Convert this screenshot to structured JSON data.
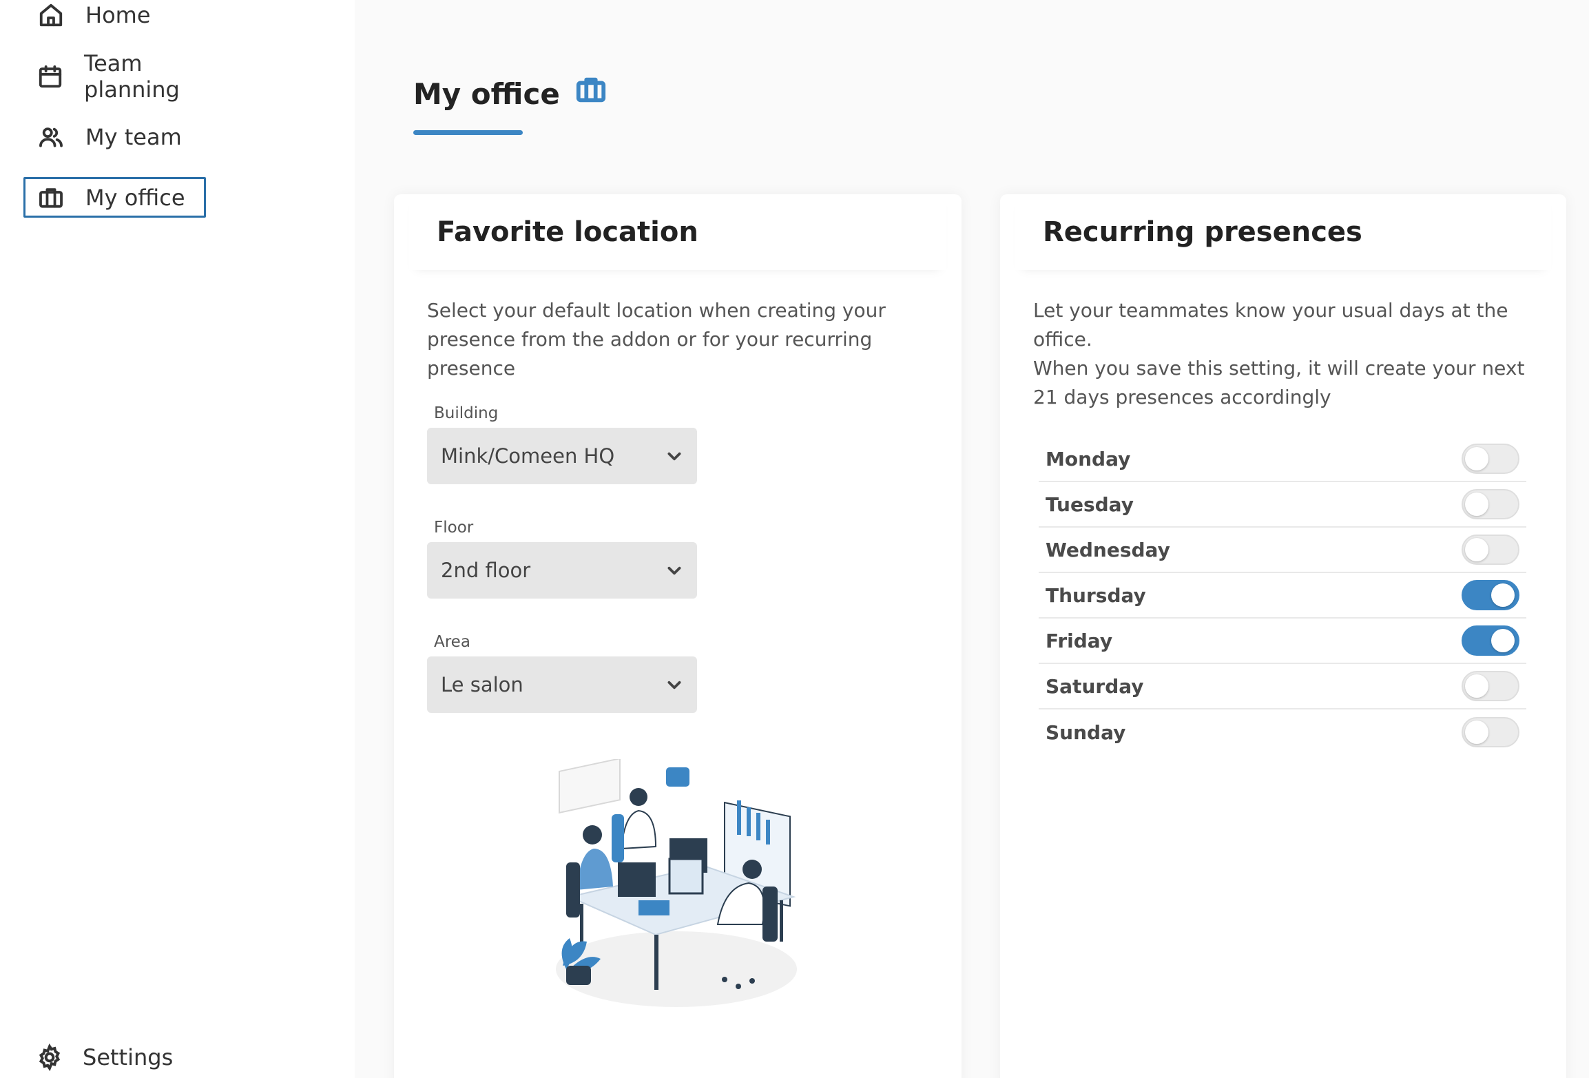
{
  "sidebar": {
    "items": [
      {
        "label": "Home",
        "icon": "home-icon"
      },
      {
        "label": "Team planning",
        "icon": "calendar-icon"
      },
      {
        "label": "My team",
        "icon": "users-icon"
      },
      {
        "label": "My office",
        "icon": "briefcase-icon",
        "active": true
      }
    ],
    "settings_label": "Settings"
  },
  "page": {
    "title": "My office",
    "accent_color": "#3c86c4"
  },
  "favorite_location": {
    "title": "Favorite location",
    "description": "Select your default location when creating your presence from the addon or for your recurring presence",
    "building": {
      "label": "Building",
      "value": "Mink/Comeen HQ"
    },
    "floor": {
      "label": "Floor",
      "value": "2nd floor"
    },
    "area": {
      "label": "Area",
      "value": "Le salon"
    }
  },
  "recurring_presences": {
    "title": "Recurring presences",
    "description_1": "Let your teammates know your usual days at the office.",
    "description_2": "When you save this setting, it will create your next 21 days presences accordingly",
    "days": [
      {
        "name": "Monday",
        "on": false
      },
      {
        "name": "Tuesday",
        "on": false
      },
      {
        "name": "Wednesday",
        "on": false
      },
      {
        "name": "Thursday",
        "on": true
      },
      {
        "name": "Friday",
        "on": true
      },
      {
        "name": "Saturday",
        "on": false
      },
      {
        "name": "Sunday",
        "on": false
      }
    ]
  }
}
